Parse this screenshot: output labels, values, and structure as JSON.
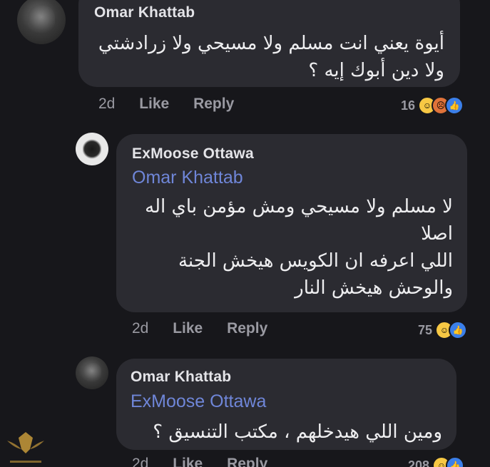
{
  "comments": [
    {
      "author": "Omar Khattab",
      "mention": "",
      "lines": [
        "أيوة يعني انت مسلم ولا مسيحي ولا زرادشتي",
        "ولا دين أبوك إيه ؟"
      ],
      "time": "2d",
      "like_label": "Like",
      "reply_label": "Reply",
      "reaction_count": "16",
      "reactions": [
        "haha-icon",
        "angry-icon",
        "like-icon"
      ]
    },
    {
      "author": "ExMoose Ottawa",
      "mention": "Omar Khattab",
      "lines": [
        "لا مسلم ولا مسيحي ومش مؤمن باي اله",
        "اصلا",
        "اللي اعرفه ان الكويس هيخش الجنة",
        "والوحش هيخش النار"
      ],
      "time": "2d",
      "like_label": "Like",
      "reply_label": "Reply",
      "reaction_count": "75",
      "reactions": [
        "haha-icon",
        "like-icon"
      ]
    },
    {
      "author": "Omar Khattab",
      "mention": "ExMoose Ottawa",
      "lines": [
        "ومين اللي هيدخلهم ، مكتب التنسيق ؟"
      ],
      "time": "2d",
      "like_label": "Like",
      "reply_label": "Reply",
      "reaction_count": "208",
      "reactions": [
        "haha-icon",
        "like-icon"
      ]
    }
  ],
  "colors": {
    "background": "#17171b",
    "bubble": "#2b2b31",
    "mention": "#6f86d8",
    "meta": "#9a9aa2"
  }
}
